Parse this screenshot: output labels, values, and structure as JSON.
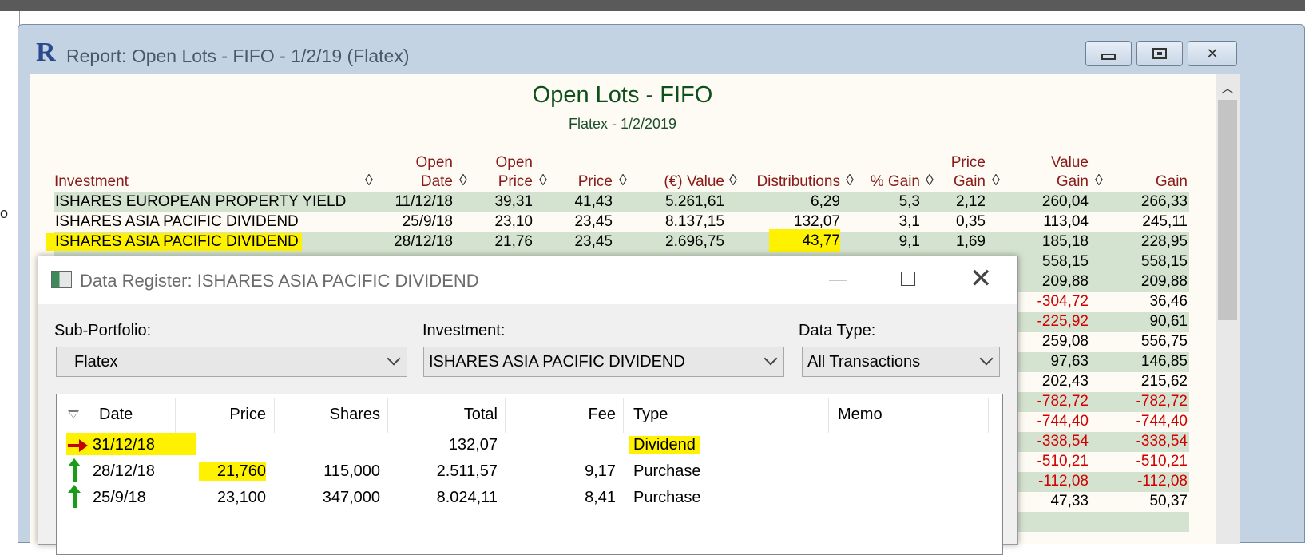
{
  "report": {
    "window_title": "Report: Open Lots - FIFO - 1/2/19 (Flatex)",
    "logo": "R",
    "title": "Open Lots - FIFO",
    "subtitle": "Flatex - 1/2/2019",
    "headers": {
      "investment": "Investment",
      "open_date_1": "Open",
      "open_date_2": "Date",
      "open_price_1": "Open",
      "open_price_2": "Price",
      "price": "Price",
      "value": "(€) Value",
      "distributions": "Distributions",
      "pct_gain": "% Gain",
      "price_gain_1": "Price",
      "price_gain_2": "Gain",
      "value_gain_1": "Value",
      "value_gain_2": "Gain",
      "gain": "Gain"
    },
    "rows": [
      {
        "name": "ISHARES EUROPEAN PROPERTY YIELD",
        "date": "11/12/18",
        "open_price": "39,31",
        "price": "41,43",
        "value": "5.261,61",
        "dist": "6,29",
        "pct": "5,3",
        "price_gain": "2,12",
        "value_gain": "260,04",
        "gain": "266,33"
      },
      {
        "name": "ISHARES ASIA PACIFIC DIVIDEND",
        "date": "25/9/18",
        "open_price": "23,10",
        "price": "23,45",
        "value": "8.137,15",
        "dist": "132,07",
        "pct": "3,1",
        "price_gain": "0,35",
        "value_gain": "113,04",
        "gain": "245,11"
      },
      {
        "name": "ISHARES ASIA PACIFIC DIVIDEND",
        "date": "28/12/18",
        "open_price": "21,76",
        "price": "23,45",
        "value": "2.696,75",
        "dist": "43,77",
        "pct": "9,1",
        "price_gain": "1,69",
        "value_gain": "185,18",
        "gain": "228,95"
      }
    ],
    "partial_rows": [
      {
        "value_gain": "558,15",
        "gain": "558,15"
      },
      {
        "value_gain": "209,88",
        "gain": "209,88"
      },
      {
        "value_gain": "-304,72",
        "gain": "36,46"
      },
      {
        "value_gain": "-225,92",
        "gain": "90,61"
      },
      {
        "value_gain": "259,08",
        "gain": "556,75"
      },
      {
        "value_gain": "97,63",
        "gain": "146,85"
      },
      {
        "value_gain": "202,43",
        "gain": "215,62"
      },
      {
        "value_gain": "-782,72",
        "gain": "-782,72"
      },
      {
        "value_gain": "-744,40",
        "gain": "-744,40"
      },
      {
        "value_gain": "-338,54",
        "gain": "-338,54"
      },
      {
        "value_gain": "-510,21",
        "gain": "-510,21"
      },
      {
        "value_gain": "-112,08",
        "gain": "-112,08"
      },
      {
        "value_gain": "47,33",
        "gain": "50,37"
      }
    ],
    "colors": {
      "title": "#0f4f1c",
      "header": "#8a1a1a",
      "shade": "#d4e3cf",
      "negative": "#d00000",
      "highlight": "#fff200"
    }
  },
  "dialog": {
    "title": "Data Register: ISHARES ASIA PACIFIC DIVIDEND",
    "sub_portfolio_label": "Sub-Portfolio:",
    "sub_portfolio_value": "Flatex",
    "investment_label": "Investment:",
    "investment_value": "ISHARES ASIA PACIFIC DIVIDEND",
    "data_type_label": "Data Type:",
    "data_type_value": "All Transactions",
    "columns": {
      "date": "Date",
      "price": "Price",
      "shares": "Shares",
      "total": "Total",
      "fee": "Fee",
      "type": "Type",
      "memo": "Memo"
    },
    "rows": [
      {
        "icon": "red-right-arrow-icon",
        "date": "31/12/18",
        "price": "",
        "shares": "",
        "total": "132,07",
        "fee": "",
        "type": "Dividend",
        "memo": ""
      },
      {
        "icon": "green-up-arrow-icon",
        "date": "28/12/18",
        "price": "21,760",
        "shares": "115,000",
        "total": "2.511,57",
        "fee": "9,17",
        "type": "Purchase",
        "memo": ""
      },
      {
        "icon": "green-up-arrow-icon",
        "date": "25/9/18",
        "price": "23,100",
        "shares": "347,000",
        "total": "8.024,11",
        "fee": "8,41",
        "type": "Purchase",
        "memo": ""
      }
    ]
  }
}
